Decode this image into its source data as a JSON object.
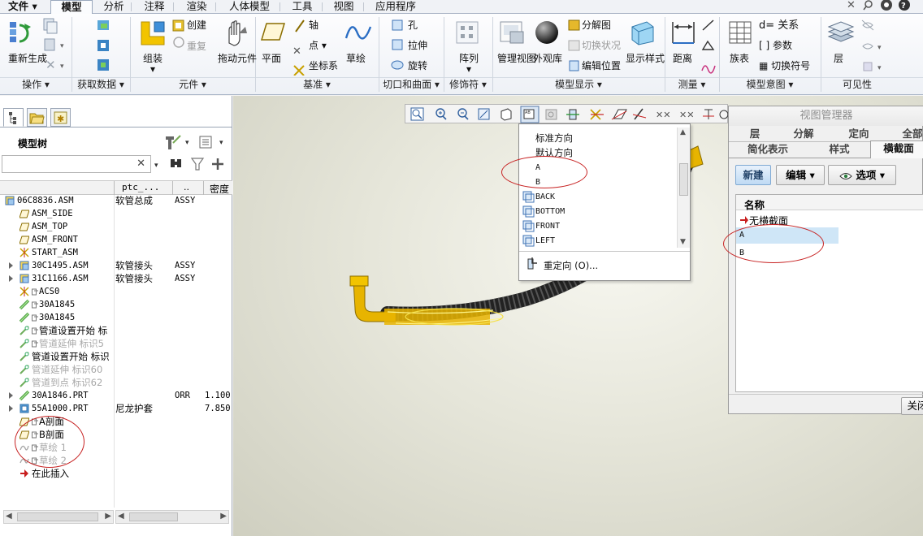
{
  "tabs": [
    {
      "label": "文件",
      "dropdown": true
    },
    {
      "label": "模型",
      "active": true
    },
    {
      "label": "分析"
    },
    {
      "label": "注释"
    },
    {
      "label": "渲染"
    },
    {
      "label": "人体模型"
    },
    {
      "label": "工具"
    },
    {
      "label": "视图"
    },
    {
      "label": "应用程序"
    }
  ],
  "ribbon": {
    "groups": [
      "操作",
      "获取数据",
      "元件",
      "基准",
      "切口和曲面",
      "修饰符",
      "模型显示",
      "测量",
      "模型意图",
      "可见性"
    ],
    "buttons": {
      "regen": "重新生成",
      "create": "创建",
      "redo": "重复",
      "assemble": "组装",
      "drag": "拖动元件",
      "plane": "平面",
      "axis": "轴",
      "point": "点",
      "csys": "坐标系",
      "sketch": "草绘",
      "hole": "孔",
      "extrude": "拉伸",
      "revolve": "旋转",
      "pattern": "阵列",
      "manager_view": "管理视图",
      "appearance": "外观库",
      "explode": "分解图",
      "toggle_status": "切换状况",
      "edit_pos": "编辑位置",
      "display_style": "显示样式",
      "distance": "距离",
      "family": "族表",
      "relations": "d= 关系",
      "params": "参数",
      "switch_sym": "切换符号",
      "layer": "层"
    }
  },
  "model_tree": {
    "title": "模型树",
    "columns": [
      "ptc_...",
      "..",
      "密度"
    ],
    "rows": [
      {
        "name": "06C8836.ASM",
        "col2": "软管总成",
        "col3": "ASSY",
        "col4": "",
        "icon": "assembly-icon",
        "indent": 0,
        "expand": false,
        "dim": false
      },
      {
        "name": "ASM_SIDE",
        "col2": "",
        "col3": "",
        "col4": "",
        "icon": "datum-plane-icon",
        "indent": 1,
        "expand": false,
        "dim": false
      },
      {
        "name": "ASM_TOP",
        "col2": "",
        "col3": "",
        "col4": "",
        "icon": "datum-plane-icon",
        "indent": 1,
        "expand": false,
        "dim": false
      },
      {
        "name": "ASM_FRONT",
        "col2": "",
        "col3": "",
        "col4": "",
        "icon": "datum-plane-icon",
        "indent": 1,
        "expand": false,
        "dim": false
      },
      {
        "name": "START_ASM",
        "col2": "",
        "col3": "",
        "col4": "",
        "icon": "csys-icon",
        "indent": 1,
        "expand": false,
        "dim": false
      },
      {
        "name": "30C1495.ASM",
        "col2": "软管接头",
        "col3": "ASSY",
        "col4": "",
        "icon": "assembly-icon",
        "indent": 1,
        "expand": true,
        "dim": false
      },
      {
        "name": "31C1166.ASM",
        "col2": "软管接头",
        "col3": "ASSY",
        "col4": "",
        "icon": "assembly-icon",
        "indent": 1,
        "expand": true,
        "dim": false
      },
      {
        "name": "ACS0",
        "col2": "",
        "col3": "",
        "col4": "",
        "icon": "csys-icon",
        "indent": 1,
        "expand": false,
        "dim": false
      },
      {
        "name": "30A1845",
        "col2": "",
        "col3": "",
        "col4": "",
        "icon": "hose-icon",
        "indent": 1,
        "expand": false,
        "dim": false
      },
      {
        "name": "30A1845",
        "col2": "",
        "col3": "",
        "col4": "",
        "icon": "hose-icon",
        "indent": 1,
        "expand": false,
        "dim": false
      },
      {
        "name": "管道设置开始 标",
        "col2": "",
        "col3": "",
        "col4": "",
        "icon": "pipe-icon",
        "indent": 1,
        "expand": false,
        "dim": false
      },
      {
        "name": "管道延伸 标识5",
        "col2": "",
        "col3": "",
        "col4": "",
        "icon": "pipe-icon",
        "indent": 1,
        "expand": false,
        "dim": true
      },
      {
        "name": "管道设置开始 标识",
        "col2": "",
        "col3": "",
        "col4": "",
        "icon": "pipe-icon",
        "indent": 1,
        "expand": false,
        "dim": false
      },
      {
        "name": "管道延伸 标识60",
        "col2": "",
        "col3": "",
        "col4": "",
        "icon": "pipe-icon",
        "indent": 1,
        "expand": false,
        "dim": true
      },
      {
        "name": "管道到点 标识62",
        "col2": "",
        "col3": "",
        "col4": "",
        "icon": "pipe-icon",
        "indent": 1,
        "expand": false,
        "dim": true
      },
      {
        "name": "30A1846.PRT",
        "col2": "",
        "col3": "ORR",
        "col4": "1.100",
        "icon": "hose-icon",
        "indent": 1,
        "expand": true,
        "dim": false
      },
      {
        "name": "55A1000.PRT",
        "col2": "尼龙护套",
        "col3": "",
        "col4": "7.850",
        "icon": "part-icon",
        "indent": 1,
        "expand": true,
        "dim": false
      },
      {
        "name": "A剖面",
        "col2": "",
        "col3": "",
        "col4": "",
        "icon": "section-icon",
        "indent": 1,
        "expand": false,
        "dim": false
      },
      {
        "name": "B剖面",
        "col2": "",
        "col3": "",
        "col4": "",
        "icon": "section-icon",
        "indent": 1,
        "expand": false,
        "dim": false
      },
      {
        "name": "草绘 1",
        "col2": "",
        "col3": "",
        "col4": "",
        "icon": "sketch-icon",
        "indent": 1,
        "expand": false,
        "dim": true
      },
      {
        "name": "草绘 2",
        "col2": "",
        "col3": "",
        "col4": "",
        "icon": "sketch-icon",
        "indent": 1,
        "expand": false,
        "dim": true
      },
      {
        "name": "在此插入",
        "col2": "",
        "col3": "",
        "col4": "",
        "icon": "insert-arrow-icon",
        "indent": 1,
        "expand": false,
        "dim": false
      }
    ]
  },
  "dropdown": {
    "items": [
      "标准方向",
      "默认方向",
      "A",
      "B",
      "BACK",
      "BOTTOM",
      "FRONT",
      "LEFT"
    ],
    "reorient": "重定向 (O)..."
  },
  "view_manager": {
    "title": "视图管理器",
    "tabs_row1": [
      "层",
      "分解",
      "定向",
      "全部"
    ],
    "tabs_row2": [
      "简化表示",
      "样式",
      "横截面"
    ],
    "btn_new": "新建",
    "btn_edit": "编辑",
    "btn_options": "选项",
    "list_header": "名称",
    "items": [
      "无横截面",
      "A",
      "B"
    ],
    "btn_close": "关闭"
  },
  "colors": {
    "accent": "#d6e8f7",
    "annotation": "#c72222",
    "hose": "#262626",
    "fitting": "#e7b400"
  }
}
